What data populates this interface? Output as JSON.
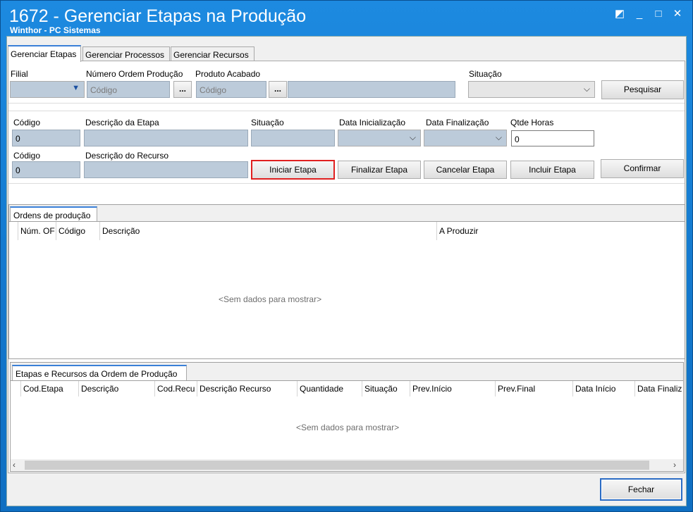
{
  "window": {
    "title": "1672 - Gerenciar Etapas na Produção",
    "subtitle": "Winthor - PC Sistemas",
    "controls": {
      "restore_icon": "◩",
      "minimize_icon": "_",
      "maximize_icon": "□",
      "close_icon": "✕"
    }
  },
  "tabs": [
    {
      "label": "Gerenciar Etapas",
      "active": true
    },
    {
      "label": "Gerenciar Processos",
      "active": false
    },
    {
      "label": "Gerenciar Recursos",
      "active": false
    }
  ],
  "filters": {
    "filial_label": "Filial",
    "ordem_label": "Número Ordem Produção",
    "ordem_placeholder": "Código",
    "produto_label": "Produto Acabado",
    "produto_placeholder": "Código",
    "situacao_label": "Situação",
    "pesquisar": "Pesquisar",
    "dots": "..."
  },
  "etapa": {
    "codigo_label": "Código",
    "codigo_value": "0",
    "descricao_label": "Descrição da Etapa",
    "situacao_label": "Situação",
    "data_ini_label": "Data Inicialização",
    "data_fin_label": "Data Finalização",
    "qtde_label": "Qtde Horas",
    "qtde_value": "0",
    "recurso_codigo_label": "Código",
    "recurso_codigo_value": "0",
    "recurso_descricao_label": "Descrição do Recurso"
  },
  "actions": {
    "iniciar": "Iniciar Etapa",
    "finalizar": "Finalizar Etapa",
    "cancelar": "Cancelar Etapa",
    "incluir": "Incluir Etapa",
    "confirmar": "Confirmar"
  },
  "ordens": {
    "tab": "Ordens de produção",
    "columns": [
      "Núm. OF",
      "Código",
      "Descrição",
      "A Produzir"
    ],
    "empty": "<Sem dados para mostrar>"
  },
  "etapas_grid": {
    "tab": "Etapas e Recursos da Ordem de Produção",
    "columns": [
      "Cod.Etapa",
      "Descrição",
      "Cod.Recu",
      "Descrição Recurso",
      "Quantidade",
      "Situação",
      "Prev.Início",
      "Prev.Final",
      "Data Início",
      "Data Finaliz"
    ],
    "empty": "<Sem dados para mostrar>"
  },
  "footer": {
    "fechar": "Fechar"
  },
  "colors": {
    "title_bar": "#1a7fd4",
    "highlight": "#e02020",
    "input_disabled": "#bccbda"
  }
}
